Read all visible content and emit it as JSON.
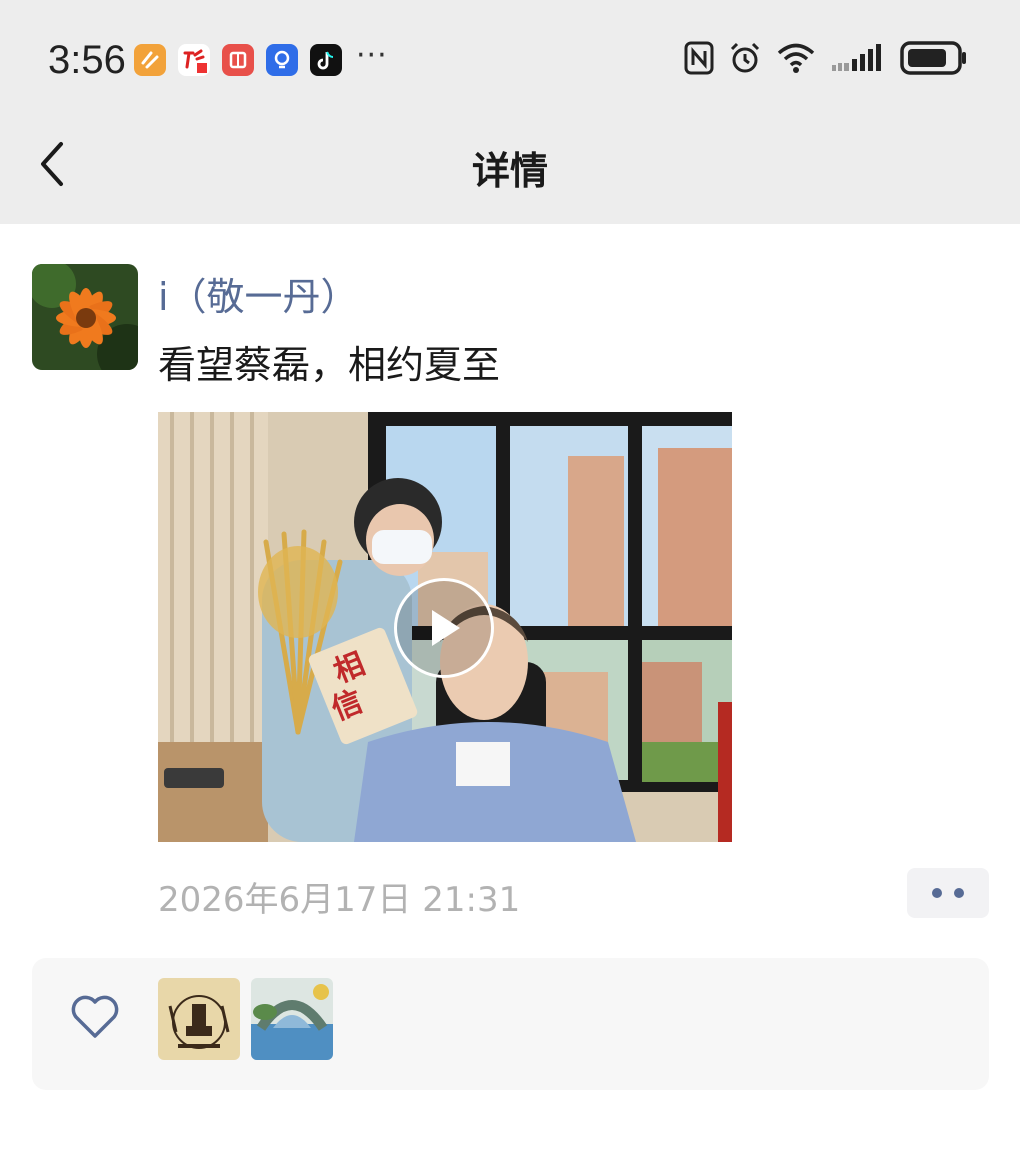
{
  "status_bar": {
    "time": "3:56",
    "app_icons": [
      {
        "name": "app-icon-orange",
        "color": "#f2a23a"
      },
      {
        "name": "app-icon-news",
        "color": "#ffffff"
      },
      {
        "name": "app-icon-red-book",
        "color": "#e8504a"
      },
      {
        "name": "app-icon-bulb",
        "color": "#2f6de8"
      },
      {
        "name": "app-icon-tiktok",
        "color": "#111111"
      }
    ],
    "more": "···",
    "system_icons": [
      "nfc-icon",
      "alarm-icon",
      "wifi-icon",
      "signal-icon",
      "battery-icon"
    ]
  },
  "nav": {
    "title": "详情",
    "back_icon": "chevron-left-icon"
  },
  "post": {
    "nickname": "i（敬一丹）",
    "text": "看望蔡磊，相约夏至",
    "timestamp": "2026年6月17日 21:31",
    "media_type": "video",
    "more_icon": "ellipsis-icon"
  },
  "likes": {
    "icon": "heart-icon",
    "likers": [
      "liker-avatar-1",
      "liker-avatar-2"
    ]
  },
  "colors": {
    "bar_bg": "#ededed",
    "link_blue": "#576b95",
    "timestamp_gray": "#b2b2b2",
    "panel_bg": "#f7f7f7"
  }
}
